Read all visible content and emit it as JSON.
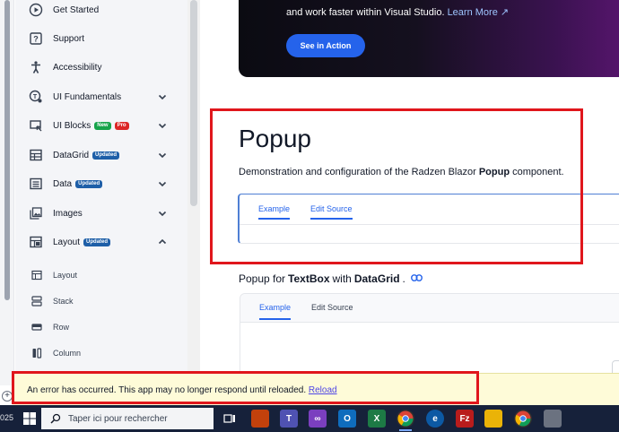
{
  "sidebar": {
    "items": [
      {
        "label": "Get Started",
        "icon": "play-circle-icon",
        "badges": [],
        "chevron": ""
      },
      {
        "label": "Support",
        "icon": "help-box-icon",
        "badges": [],
        "chevron": ""
      },
      {
        "label": "Accessibility",
        "icon": "accessibility-icon",
        "badges": [],
        "chevron": ""
      },
      {
        "label": "UI Fundamentals",
        "icon": "ui-fundamentals-icon",
        "badges": [],
        "chevron": "down"
      },
      {
        "label": "UI Blocks",
        "icon": "ui-blocks-icon",
        "badges": [
          "New",
          "Pro"
        ],
        "chevron": "down"
      },
      {
        "label": "DataGrid",
        "icon": "grid-icon",
        "badges": [
          "Updated"
        ],
        "chevron": "down"
      },
      {
        "label": "Data",
        "icon": "data-list-icon",
        "badges": [
          "Updated"
        ],
        "chevron": "down"
      },
      {
        "label": "Images",
        "icon": "images-icon",
        "badges": [],
        "chevron": "down"
      },
      {
        "label": "Layout",
        "icon": "layout-icon",
        "badges": [
          "Updated"
        ],
        "chevron": "up"
      }
    ],
    "subitems": [
      {
        "label": "Layout",
        "icon": "layout-sub-icon"
      },
      {
        "label": "Stack",
        "icon": "stack-icon"
      },
      {
        "label": "Row",
        "icon": "row-icon"
      },
      {
        "label": "Column",
        "icon": "column-icon"
      }
    ]
  },
  "hero": {
    "text": "and work faster within Visual Studio.",
    "link": "Learn More ↗",
    "button": "See in Action"
  },
  "popup": {
    "title": "Popup",
    "desc_prefix": "Demonstration and configuration of the Radzen Blazor ",
    "desc_bold": "Popup",
    "desc_suffix": " component.",
    "tabs": [
      "Example",
      "Edit Source"
    ]
  },
  "section": {
    "prefix": "Popup for ",
    "bold1": "TextBox",
    "middle": " with ",
    "bold2": "DataGrid",
    "suffix": ".",
    "tabs": [
      "Example",
      "Edit Source"
    ]
  },
  "error": {
    "message": "An error has occurred. This app may no longer respond until reloaded.",
    "reload": "Reload"
  },
  "taskbar": {
    "year": "025",
    "search_placeholder": "Taper ici pour rechercher"
  },
  "colors": {
    "accent": "#2563eb",
    "annotation_red": "#e0161c",
    "error_bg": "#fefbd8",
    "taskbar_bg": "#16213a"
  }
}
